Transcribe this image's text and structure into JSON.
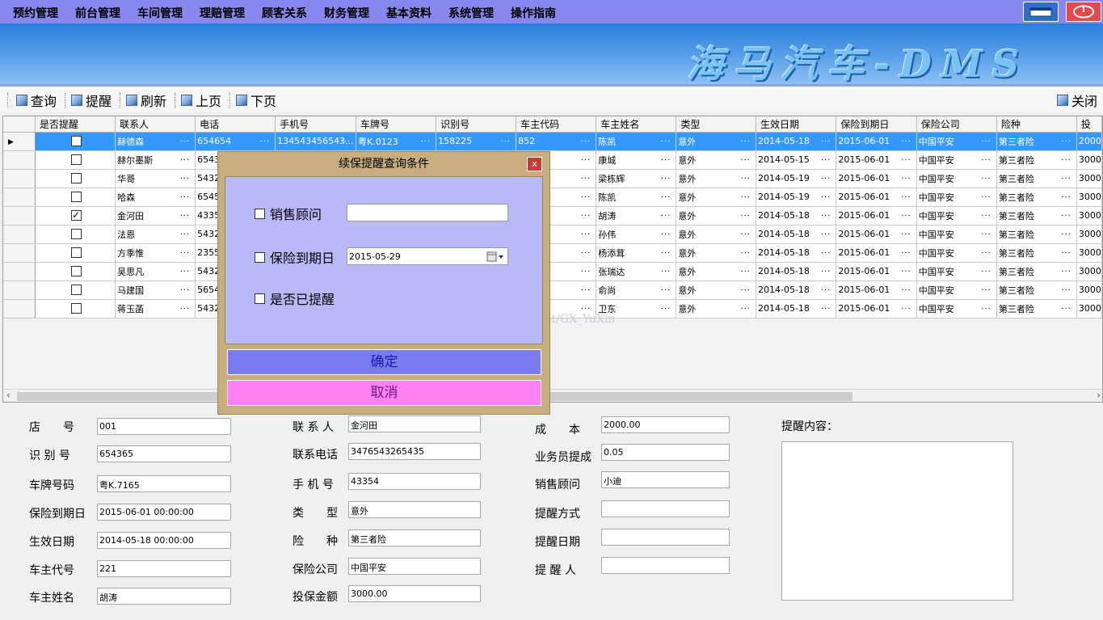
{
  "menu": {
    "items": [
      "预约管理",
      "前台管理",
      "车间管理",
      "理赔管理",
      "顾客关系",
      "财务管理",
      "基本资料",
      "系统管理",
      "操作指南"
    ]
  },
  "banner": {
    "title": "海马汽车-DMS"
  },
  "toolbar": {
    "query": "查询",
    "remind": "提醒",
    "refresh": "刷新",
    "prev_page": "上页",
    "next_page": "下页",
    "close": "关闭"
  },
  "grid": {
    "columns": [
      "是否提醒",
      "联系人",
      "电话",
      "手机号",
      "车牌号",
      "识别号",
      "车主代码",
      "车主姓名",
      "类型",
      "生效日期",
      "保险到期日",
      "保险公司",
      "险种",
      "投"
    ],
    "rows": [
      {
        "reminded": false,
        "contact": "赫德森",
        "phone": "654654",
        "mobile": "134543456543...",
        "plate": "粤K.0123",
        "vin": "158225",
        "owner_code": "852",
        "owner": "陈凯",
        "type": "意外",
        "start": "2014-05-18",
        "expire": "2015-06-01",
        "insurer": "中国平安",
        "coverage": "第三者险",
        "amount": "2000"
      },
      {
        "reminded": false,
        "contact": "赫尔墨斯",
        "phone": "6543",
        "mobile": "",
        "plate": "",
        "vin": "",
        "owner_code": "",
        "owner": "康城",
        "type": "意外",
        "start": "2014-05-15",
        "expire": "2015-06-01",
        "insurer": "中国平安",
        "coverage": "第三者险",
        "amount": "3000"
      },
      {
        "reminded": false,
        "contact": "华哥",
        "phone": "5432",
        "mobile": "",
        "plate": "",
        "vin": "",
        "owner_code": "",
        "owner": "梁栋辉",
        "type": "意外",
        "start": "2014-05-19",
        "expire": "2015-06-01",
        "insurer": "中国平安",
        "coverage": "第三者险",
        "amount": "3000"
      },
      {
        "reminded": false,
        "contact": "哈森",
        "phone": "6545",
        "mobile": "",
        "plate": "",
        "vin": "",
        "owner_code": "",
        "owner": "陈凯",
        "type": "意外",
        "start": "2014-05-19",
        "expire": "2015-06-01",
        "insurer": "中国平安",
        "coverage": "第三者险",
        "amount": "3000"
      },
      {
        "reminded": true,
        "contact": "金河田",
        "phone": "4335",
        "mobile": "",
        "plate": "",
        "vin": "",
        "owner_code": "",
        "owner": "胡涛",
        "type": "意外",
        "start": "2014-05-18",
        "expire": "2015-06-01",
        "insurer": "中国平安",
        "coverage": "第三者险",
        "amount": "3000"
      },
      {
        "reminded": false,
        "contact": "法恩",
        "phone": "5432",
        "mobile": "",
        "plate": "",
        "vin": "",
        "owner_code": "",
        "owner": "孙伟",
        "type": "意外",
        "start": "2014-05-18",
        "expire": "2015-06-01",
        "insurer": "中国平安",
        "coverage": "第三者险",
        "amount": "3000"
      },
      {
        "reminded": false,
        "contact": "方季惟",
        "phone": "2355",
        "mobile": "",
        "plate": "",
        "vin": "",
        "owner_code": "",
        "owner": "杨添茸",
        "type": "意外",
        "start": "2014-05-18",
        "expire": "2015-06-01",
        "insurer": "中国平安",
        "coverage": "第三者险",
        "amount": "3000"
      },
      {
        "reminded": false,
        "contact": "吴思凡",
        "phone": "5432",
        "mobile": "",
        "plate": "",
        "vin": "",
        "owner_code": "",
        "owner": "张瑞达",
        "type": "意外",
        "start": "2014-05-18",
        "expire": "2015-06-01",
        "insurer": "中国平安",
        "coverage": "第三者险",
        "amount": "3000"
      },
      {
        "reminded": false,
        "contact": "马建国",
        "phone": "5654",
        "mobile": "",
        "plate": "",
        "vin": "",
        "owner_code": "",
        "owner": "俞尚",
        "type": "意外",
        "start": "2014-05-18",
        "expire": "2015-06-01",
        "insurer": "中国平安",
        "coverage": "第三者险",
        "amount": "3000"
      },
      {
        "reminded": false,
        "contact": "蒋玉菡",
        "phone": "5432",
        "mobile": "",
        "plate": "",
        "vin": "",
        "owner_code": "",
        "owner": "卫东",
        "type": "意外",
        "start": "2014-05-18",
        "expire": "2015-06-01",
        "insurer": "中国平安",
        "coverage": "第三者险",
        "amount": "3000"
      }
    ]
  },
  "watermark": "http://blog.csdn.net/GX_YuXin",
  "detail": {
    "store_label": "店　　号",
    "store_value": "001",
    "vin_label": "识 别 号",
    "vin_value": "654365",
    "plate_label": "车牌号码",
    "plate_value": "粤K.7165",
    "expire_label": "保险到期日",
    "expire_value": "2015-06-01 00:00:00",
    "start_label": "生效日期",
    "start_value": "2014-05-18 00:00:00",
    "owner_code_label": "车主代号",
    "owner_code_value": "221",
    "owner_name_label": "车主姓名",
    "owner_name_value": "胡涛",
    "contact_label": "联 系 人",
    "contact_value": "金河田",
    "phone_label": "联系电话",
    "phone_value": "3476543265435",
    "mobile_label": "手 机 号",
    "mobile_value": "43354",
    "type_label": "类　　型",
    "type_value": "意外",
    "coverage_label": "险　　种",
    "coverage_value": "第三者险",
    "insurer_label": "保险公司",
    "insurer_value": "中国平安",
    "amount_label": "投保金额",
    "amount_value": "3000.00",
    "cost_label": "成　　本",
    "cost_value": "2000.00",
    "commission_label": "业务员提成",
    "commission_value": "0.05",
    "consultant_label": "销售顾问",
    "consultant_value": "小迪",
    "remind_method_label": "提醒方式",
    "remind_method_value": "",
    "remind_date_label": "提醒日期",
    "remind_date_value": "",
    "reminder_label": "提 醒 人",
    "reminder_value": "",
    "remind_content_label": "提醒内容："
  },
  "dialog": {
    "title": "续保提醒查询条件",
    "close": "x",
    "consultant_label": "销售顾问",
    "consultant_value": "",
    "expire_label": "保险到期日",
    "expire_value": "2015-05-29",
    "reminded_label": "是否已提醒",
    "ok": "确定",
    "cancel": "取消"
  },
  "colors": {
    "menubar": "#8787ee",
    "selected_row": "#3399ff",
    "dialog_frame": "#c8ad7e",
    "dialog_body": "#b9b9f8",
    "ok_button": "#7b7bf0",
    "cancel_button": "#ff80f2"
  },
  "icons": {
    "toolbar": "image-icon",
    "minimize": "minimize-icon",
    "exit": "exit-icon",
    "calendar": "calendar-icon",
    "row_pointer": "row-pointer-icon"
  }
}
